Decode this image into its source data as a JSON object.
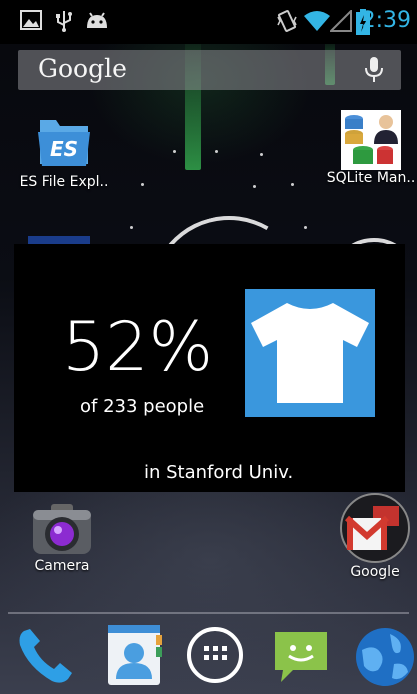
{
  "status_bar": {
    "time": "2:39",
    "left_icons": [
      "image-icon",
      "usb-icon",
      "android-debug-icon"
    ],
    "right_icons": [
      "vibrate-icon",
      "wifi-icon",
      "signal-icon",
      "battery-icon"
    ],
    "accent_color": "#33b5e5"
  },
  "search": {
    "logo": "Google",
    "mic_icon": "mic-icon"
  },
  "apps": {
    "es_file": {
      "label": "ES File Expl.."
    },
    "sqlite": {
      "label": "SQLite Man.."
    },
    "camera": {
      "label": "Camera"
    },
    "google_folder": {
      "label": "Google"
    }
  },
  "widget": {
    "percent": "52%",
    "people": "of 233 people",
    "location": "in Stanford Univ.",
    "shirt_color": "#3a97dd",
    "icon": "t-shirt-icon"
  },
  "dock": {
    "items": [
      "phone-icon",
      "contacts-icon",
      "app-drawer-icon",
      "messaging-icon",
      "browser-icon"
    ]
  }
}
